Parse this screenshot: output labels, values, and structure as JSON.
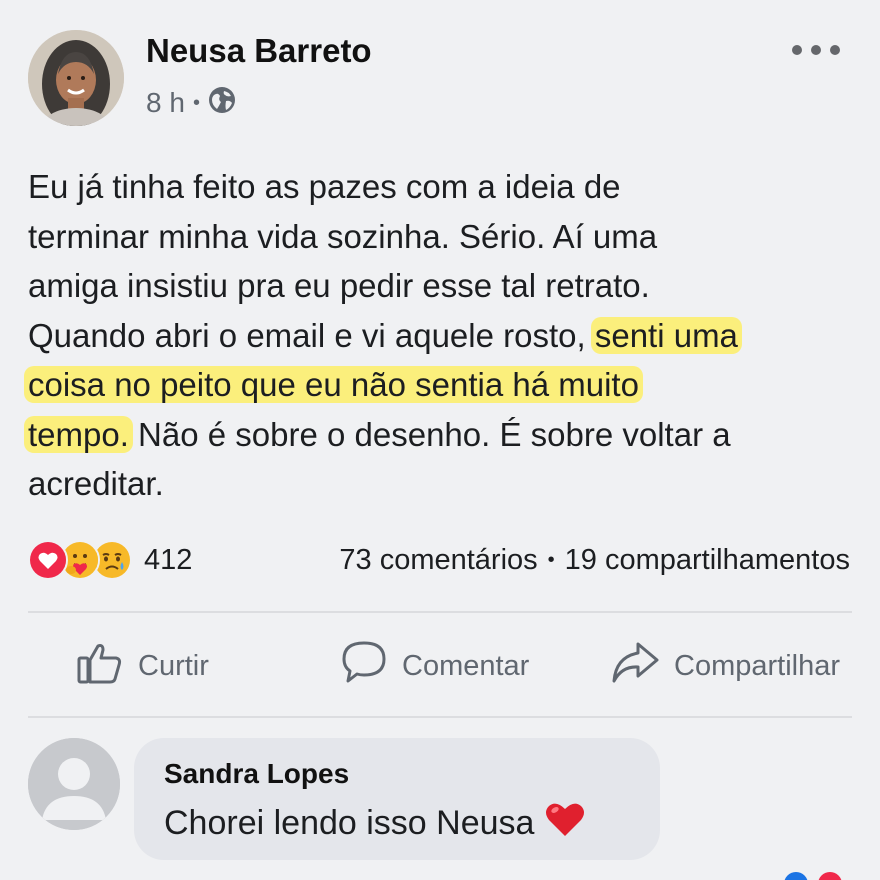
{
  "post": {
    "author": "Neusa Barreto",
    "time": "8 h",
    "audience_icon": "globe-icon",
    "more_icon": "more-dots-icon",
    "text": {
      "l1": "Eu já tinha feito as pazes com a ideia de",
      "l2": "terminar minha vida sozinha. Sério. Aí uma",
      "l3": "amiga insistiu pra eu pedir esse tal retrato.",
      "l4a": "Quando abri o email e vi aquele rosto, ",
      "l4b": "senti uma",
      "l5": "coisa no peito que eu não sentia há muito",
      "l6a": "tempo.",
      "l6b": " Não é sobre o desenho. É sobre voltar a",
      "l7": "acreditar."
    },
    "highlight_color": "#fbef7c"
  },
  "engagement": {
    "reaction_icons": [
      "heart-reaction-icon",
      "care-reaction-icon",
      "sad-reaction-icon"
    ],
    "reaction_count": "412",
    "comments": "73 comentários",
    "shares": "19 compartilhamentos",
    "separator": "•"
  },
  "actions": {
    "like": "Curtir",
    "comment": "Comentar",
    "share": "Compartilhar"
  },
  "comment": {
    "author": "Sandra Lopes",
    "text": "Chorei lendo isso Neusa",
    "emoji_icon": "red-heart-icon"
  },
  "colors": {
    "background": "#f0f1f3",
    "text": "#1c1e21",
    "secondary": "#606770",
    "bubble": "#e4e6eb",
    "reaction_red": "#f0284a",
    "reaction_yellow": "#f7b928"
  }
}
